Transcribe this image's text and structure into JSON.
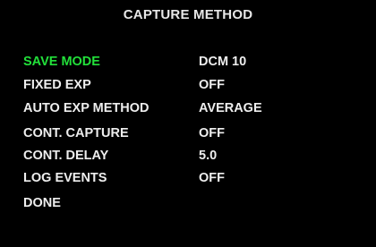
{
  "title": "CAPTURE METHOD",
  "colors": {
    "background": "#000000",
    "text": "#eeeeee",
    "selected": "#22e03a"
  },
  "menu": {
    "items": [
      {
        "label": "SAVE MODE",
        "value": "DCM 10",
        "selected": true
      },
      {
        "label": "FIXED EXP",
        "value": "OFF",
        "selected": false
      },
      {
        "label": "AUTO EXP METHOD",
        "value": "AVERAGE",
        "selected": false
      },
      {
        "label": "CONT. CAPTURE",
        "value": "OFF",
        "selected": false
      },
      {
        "label": "CONT. DELAY",
        "value": "5.0",
        "selected": false
      },
      {
        "label": "LOG EVENTS",
        "value": "OFF",
        "selected": false
      },
      {
        "label": "DONE",
        "value": "",
        "selected": false
      }
    ]
  }
}
